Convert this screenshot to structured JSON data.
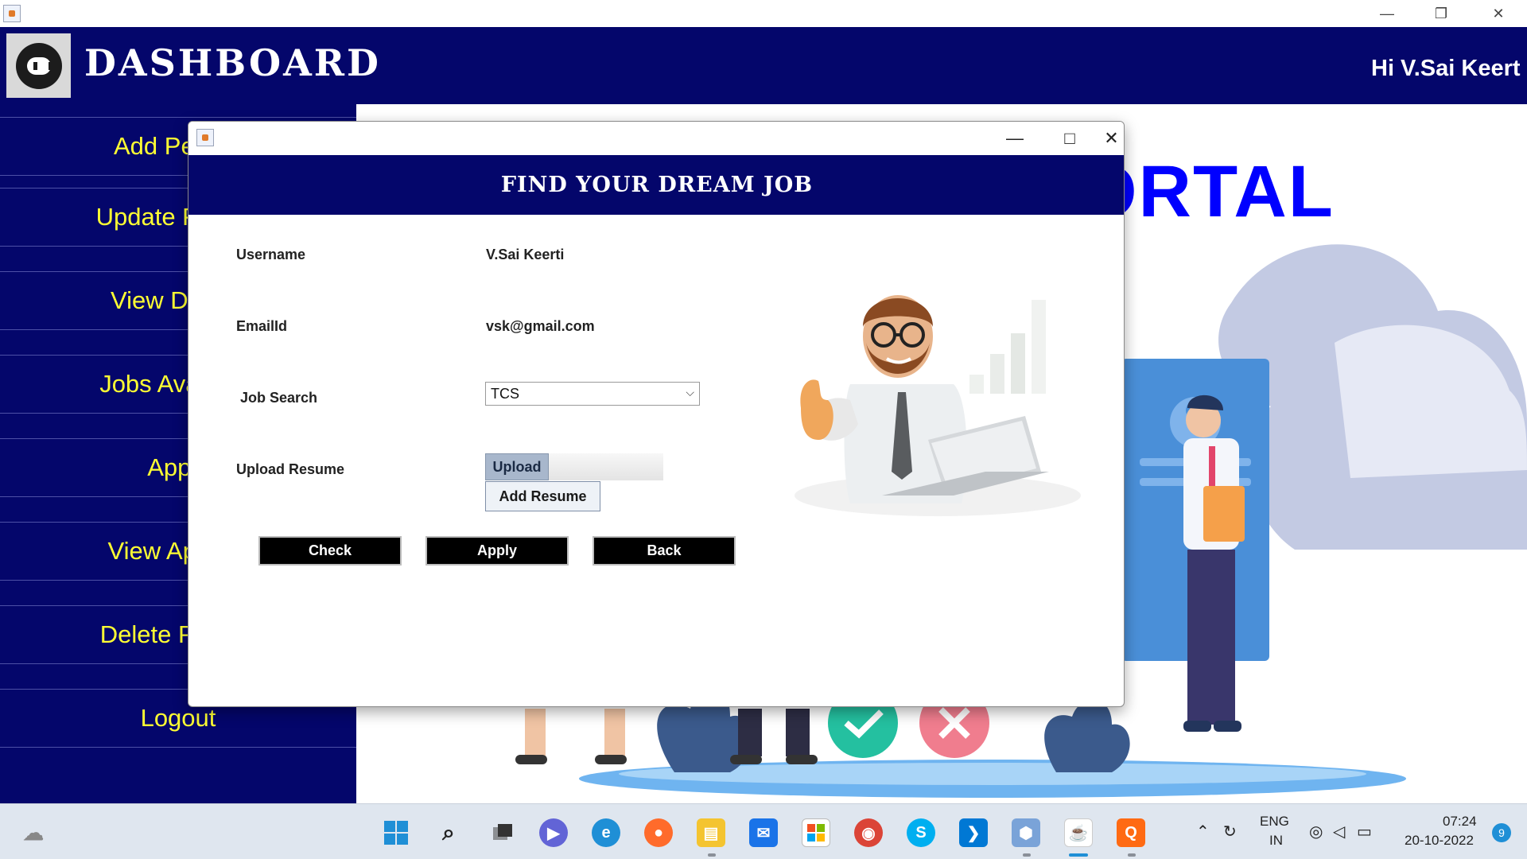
{
  "header": {
    "title": "DASHBOARD",
    "greeting": "Hi V.Sai Keert"
  },
  "sidebar": {
    "items": [
      {
        "label": "Add Person"
      },
      {
        "label": "Update Person"
      },
      {
        "label": "View Details"
      },
      {
        "label": "Jobs Available"
      },
      {
        "label": "Apply"
      },
      {
        "label": "View Applied"
      },
      {
        "label": "Delete Person"
      },
      {
        "label": "Logout"
      }
    ]
  },
  "background": {
    "portal_text": "ORTAL"
  },
  "modal": {
    "banner": "FIND YOUR DREAM JOB",
    "username_label": "Username",
    "username_value": "V.Sai Keerti",
    "email_label": "EmailId",
    "email_value": "vsk@gmail.com",
    "job_search_label": "Job Search",
    "job_search_value": "TCS",
    "upload_resume_label": "Upload Resume",
    "upload_button": "Upload",
    "add_resume_button": "Add Resume",
    "check_button": "Check",
    "apply_button": "Apply",
    "back_button": "Back"
  },
  "taskbar": {
    "lang_line1": "ENG",
    "lang_line2": "IN",
    "time": "07:24",
    "date": "20-10-2022",
    "notification_count": "9"
  },
  "colors": {
    "navy": "#04066b",
    "sidebar_text": "#ffff33",
    "portal_text": "#0000ff",
    "upload_button": "#a8b7cc"
  }
}
